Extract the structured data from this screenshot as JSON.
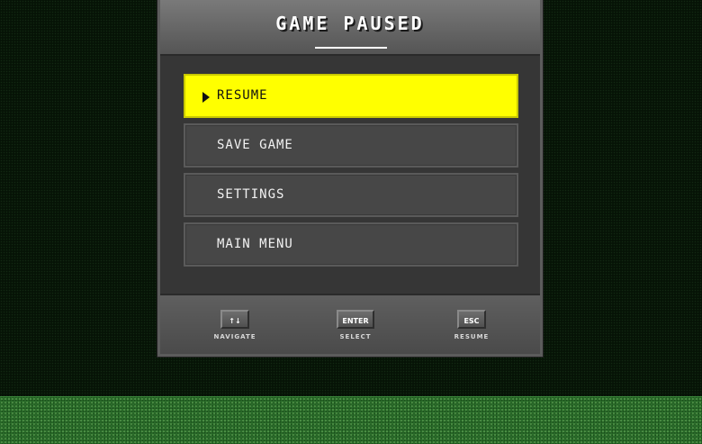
{
  "pause_menu": {
    "title": "GAME PAUSED",
    "selected_index": 0,
    "items": [
      {
        "label": "RESUME"
      },
      {
        "label": "SAVE GAME"
      },
      {
        "label": "SETTINGS"
      },
      {
        "label": "MAIN MENU"
      }
    ]
  },
  "controls": [
    {
      "key": "↑↓",
      "action": "NAVIGATE"
    },
    {
      "key": "ENTER",
      "action": "SELECT"
    },
    {
      "key": "ESC",
      "action": "RESUME"
    }
  ],
  "colors": {
    "highlight": "#ffff00",
    "panel": "#3a3a3a",
    "background": "#061306",
    "ground": "#2a6b2a"
  }
}
